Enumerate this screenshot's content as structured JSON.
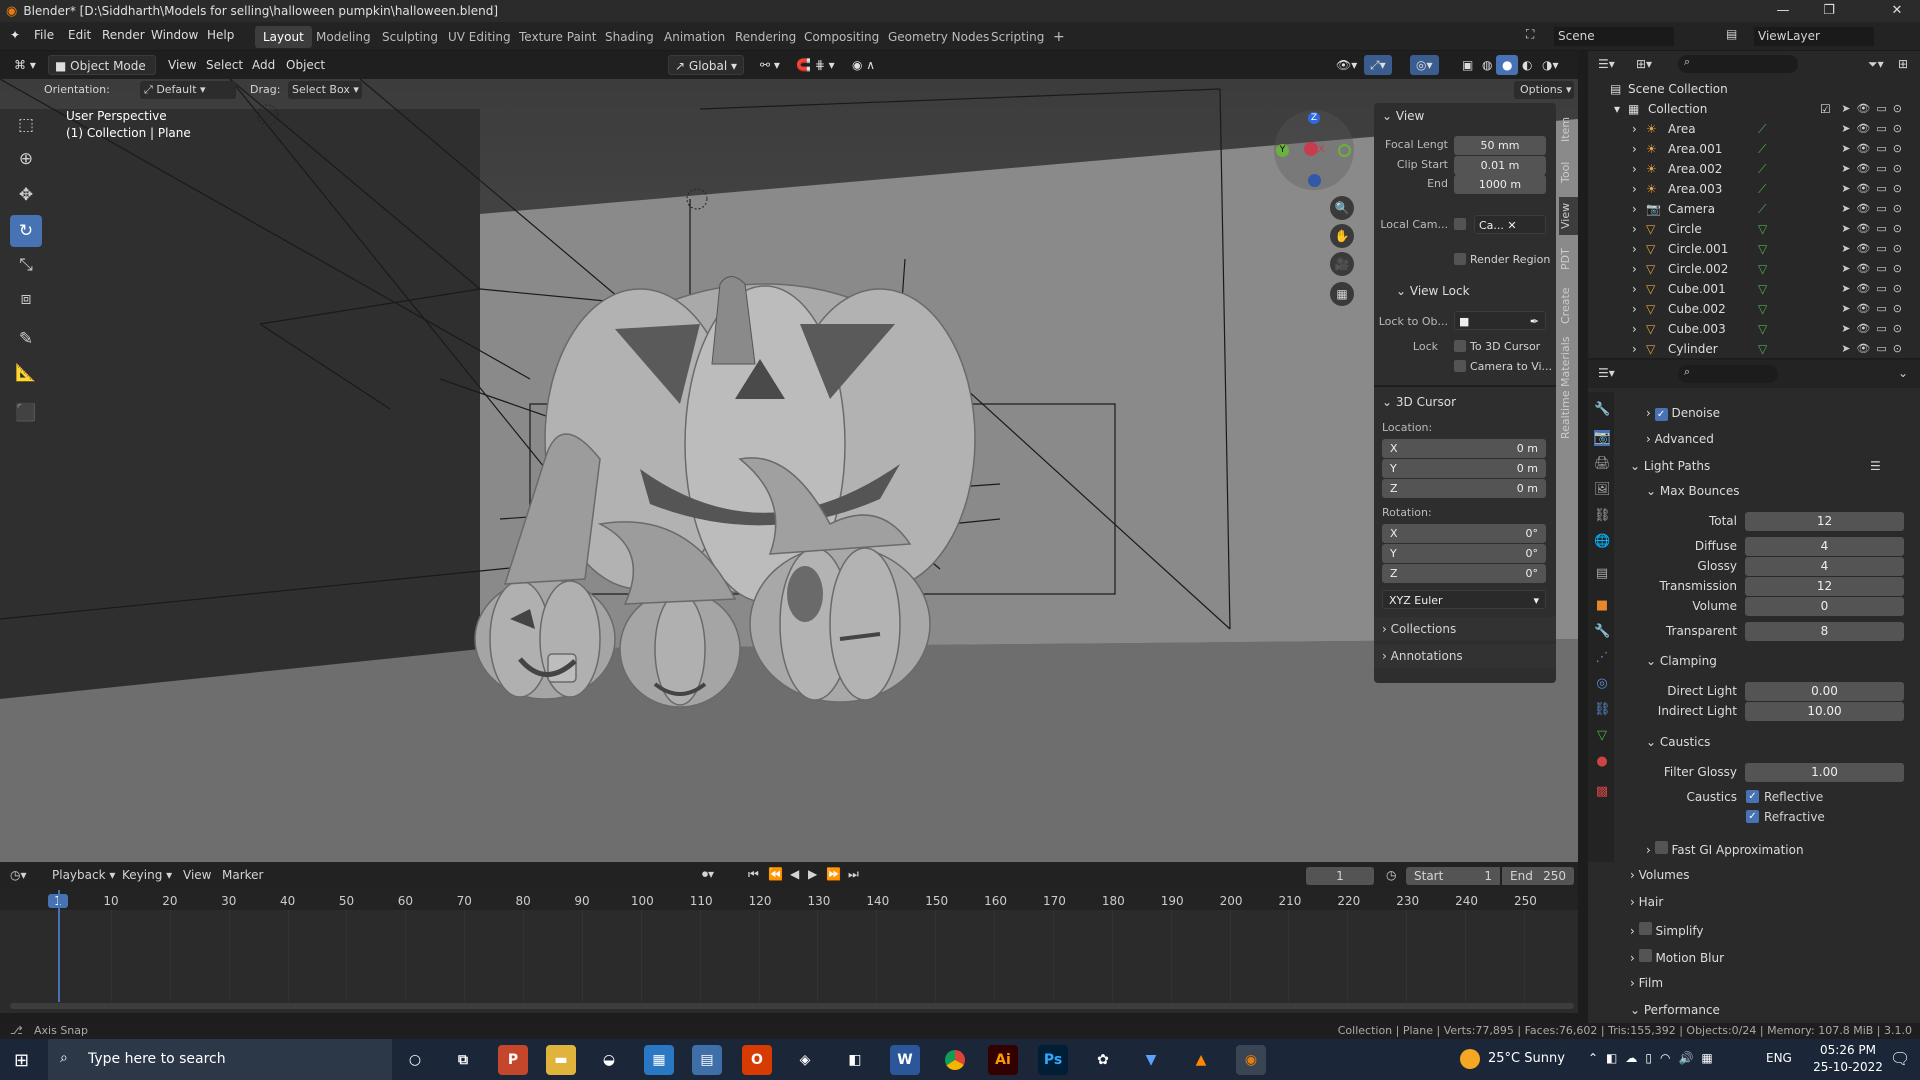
{
  "window": {
    "title": "Blender* [D:\\Siddharth\\Models for selling\\halloween pumpkin\\halloween.blend]",
    "min": "—",
    "max": "❐",
    "close": "✕"
  },
  "menu": {
    "file": "File",
    "edit": "Edit",
    "render": "Render",
    "window": "Window",
    "help": "Help"
  },
  "workspaces": [
    "Layout",
    "Modeling",
    "Sculpting",
    "UV Editing",
    "Texture Paint",
    "Shading",
    "Animation",
    "Rendering",
    "Compositing",
    "Geometry Nodes",
    "Scripting"
  ],
  "scene": {
    "scene": "Scene",
    "view_layer": "ViewLayer"
  },
  "vp_header": {
    "mode": "Object Mode",
    "view": "View",
    "select": "Select",
    "add": "Add",
    "object": "Object",
    "transform": "Global"
  },
  "vp_sub": {
    "orientation_label": "Orientation:",
    "orientation": "Default",
    "drag_label": "Drag:",
    "drag": "Select Box",
    "options": "Options"
  },
  "viewport": {
    "line1": "User Perspective",
    "line2": "(1) Collection | Plane"
  },
  "npanel": {
    "view_title": "View",
    "focal_label": "Focal Lengt",
    "focal": "50 mm",
    "clip_start_label": "Clip Start",
    "clip_start": "0.01 m",
    "end_label": "End",
    "end": "1000 m",
    "local_cam_label": "Local Cam...",
    "local_cam": "Ca...",
    "render_region": "Render Region",
    "view_lock_title": "View Lock",
    "lock_to_obj_label": "Lock to Ob...",
    "lock_label": "Lock",
    "to_3d_cursor": "To 3D Cursor",
    "camera_to_view": "Camera to Vi...",
    "cursor_title": "3D Cursor",
    "location_label": "Location:",
    "loc": [
      {
        "axis": "X",
        "val": "0 m"
      },
      {
        "axis": "Y",
        "val": "0 m"
      },
      {
        "axis": "Z",
        "val": "0 m"
      }
    ],
    "rotation_label": "Rotation:",
    "rot": [
      {
        "axis": "X",
        "val": "0°"
      },
      {
        "axis": "Y",
        "val": "0°"
      },
      {
        "axis": "Z",
        "val": "0°"
      }
    ],
    "rot_mode": "XYZ Euler",
    "collections": "Collections",
    "annotations": "Annotations",
    "tabs": [
      "Item",
      "Tool",
      "View",
      "PDT",
      "Create",
      "Realtime Materials"
    ]
  },
  "outliner": {
    "root": "Scene Collection",
    "collection": "Collection",
    "items": [
      {
        "name": "Area",
        "type": "light"
      },
      {
        "name": "Area.001",
        "type": "light"
      },
      {
        "name": "Area.002",
        "type": "light"
      },
      {
        "name": "Area.003",
        "type": "light"
      },
      {
        "name": "Camera",
        "type": "camera"
      },
      {
        "name": "Circle",
        "type": "mesh"
      },
      {
        "name": "Circle.001",
        "type": "mesh"
      },
      {
        "name": "Circle.002",
        "type": "mesh"
      },
      {
        "name": "Cube.001",
        "type": "mesh"
      },
      {
        "name": "Cube.002",
        "type": "mesh"
      },
      {
        "name": "Cube.003",
        "type": "mesh"
      },
      {
        "name": "Cylinder",
        "type": "mesh"
      }
    ]
  },
  "properties": {
    "denoise": "Denoise",
    "advanced": "Advanced",
    "light_paths": "Light Paths",
    "max_bounces": "Max Bounces",
    "total_label": "Total",
    "total": "12",
    "diffuse_label": "Diffuse",
    "diffuse": "4",
    "glossy_label": "Glossy",
    "glossy": "4",
    "transmission_label": "Transmission",
    "transmission": "12",
    "volume_label": "Volume",
    "volume": "0",
    "transparent_label": "Transparent",
    "transparent": "8",
    "clamping": "Clamping",
    "direct_light_label": "Direct Light",
    "direct_light": "0.00",
    "indirect_light_label": "Indirect Light",
    "indirect_light": "10.00",
    "caustics_head": "Caustics",
    "filter_glossy_label": "Filter Glossy",
    "filter_glossy": "1.00",
    "caustics_label": "Caustics",
    "reflective": "Reflective",
    "refractive": "Refractive",
    "fast_gi": "Fast GI Approximation",
    "volumes": "Volumes",
    "hair": "Hair",
    "simplify": "Simplify",
    "motion_blur": "Motion Blur",
    "film": "Film",
    "performance": "Performance"
  },
  "timeline": {
    "playback": "Playback",
    "keying": "Keying",
    "view": "View",
    "marker": "Marker",
    "current_frame": "1",
    "start_label": "Start",
    "start": "1",
    "end_label": "End",
    "end": "250",
    "ticks": [
      "1",
      "10",
      "20",
      "30",
      "40",
      "50",
      "60",
      "70",
      "80",
      "90",
      "100",
      "110",
      "120",
      "130",
      "140",
      "150",
      "160",
      "170",
      "180",
      "190",
      "200",
      "210",
      "220",
      "230",
      "240",
      "250"
    ]
  },
  "statusbar": {
    "left": "Axis Snap",
    "right": "Collection | Plane | Verts:77,895 | Faces:76,602 | Tris:155,392 | Objects:0/24 | Memory: 107.8 MiB | 3.1.0"
  },
  "taskbar": {
    "search": "Type here to search",
    "weather": "25°C  Sunny",
    "lang": "ENG",
    "time": "05:26 PM",
    "date": "25-10-2022"
  },
  "colors": {
    "accent": "#4772b3",
    "bg": "#3d3d3d"
  }
}
